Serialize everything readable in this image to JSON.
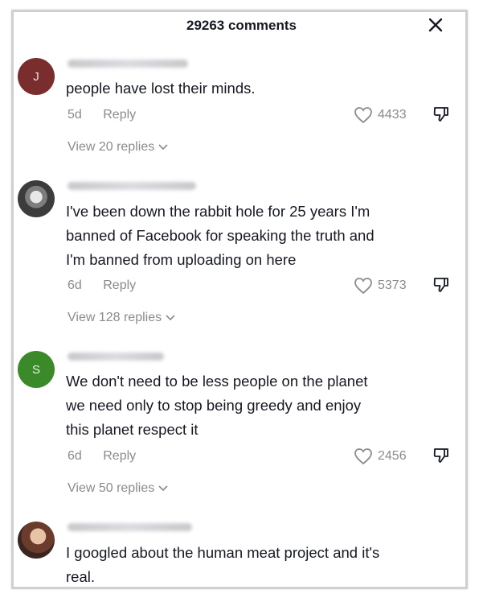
{
  "header": {
    "count_label": "29263 comments"
  },
  "comments": [
    {
      "username": "annettemaribam1280",
      "text": "people have lost their minds.",
      "age": "5d",
      "reply_label": "Reply",
      "likes": "4433",
      "view_replies": "View 20 replies",
      "avatar_letter": "J",
      "avatar_color": "#7a2d2d"
    },
    {
      "username": "realitalkmaddogs007",
      "text_lines": [
        "I've been down the rabbit hole for 25 years I'm",
        "banned of Facebook for speaking the truth and",
        "I'm banned from uploading on here"
      ],
      "age": "6d",
      "reply_label": "Reply",
      "likes": "5373",
      "view_replies": "View 128 replies"
    },
    {
      "username": "sergiuniator17",
      "text_lines": [
        "We don't need to be less people on the planet",
        "we need only to stop being greedy and enjoy",
        "this planet respect it"
      ],
      "age": "6d",
      "reply_label": "Reply",
      "likes": "2456",
      "view_replies": "View 50 replies",
      "avatar_letter": "S",
      "avatar_color": "#3a8a2a"
    },
    {
      "username": "annettengsahlena75",
      "text_lines": [
        "I googled about the human meat project and it's",
        "real."
      ]
    }
  ]
}
